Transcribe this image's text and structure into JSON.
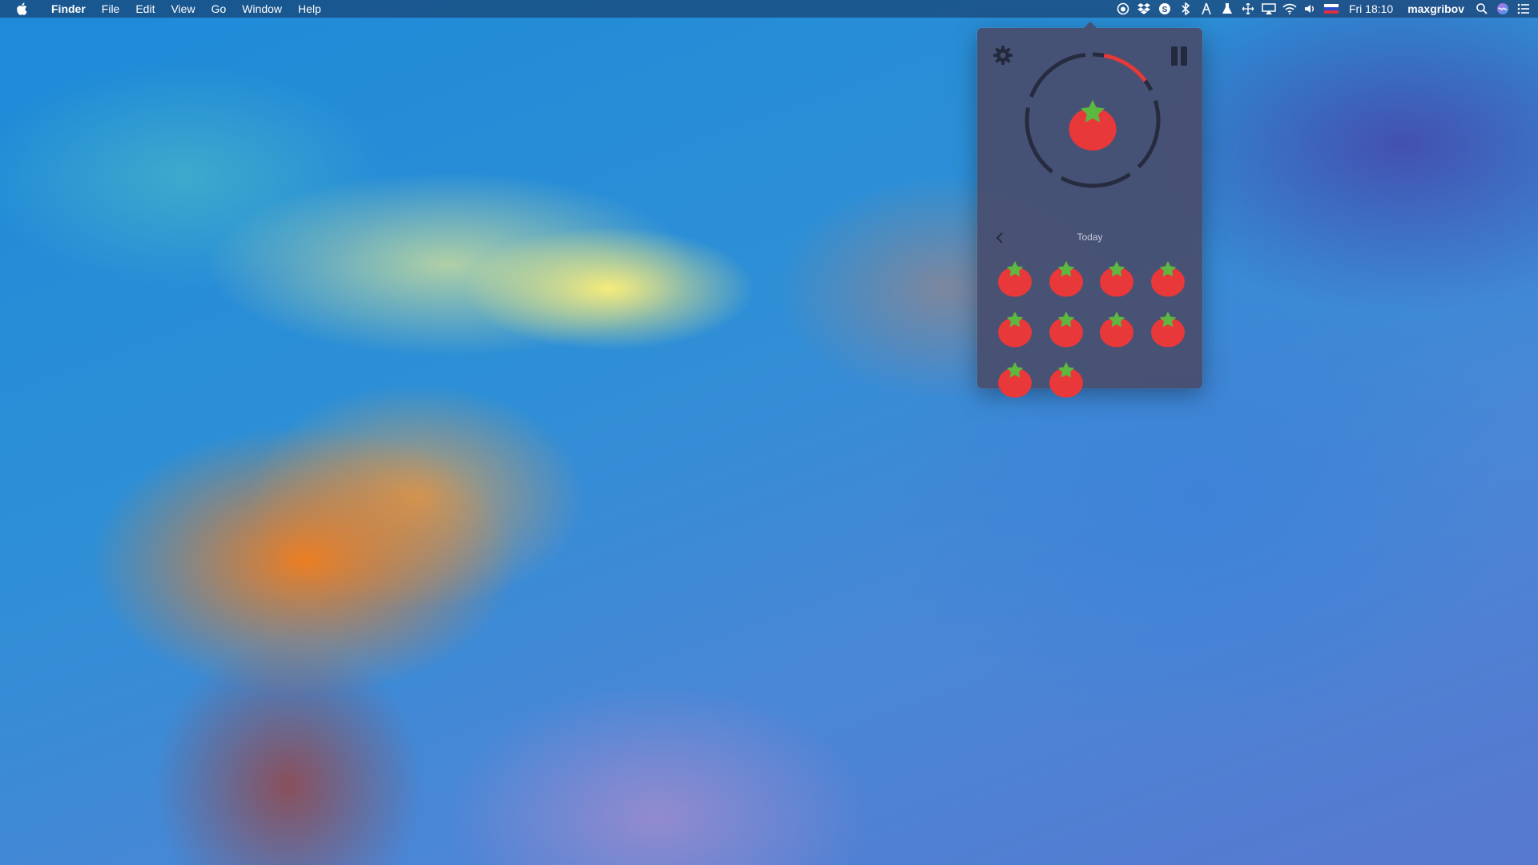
{
  "menubar": {
    "app_name": "Finder",
    "menus": [
      "File",
      "Edit",
      "View",
      "Go",
      "Window",
      "Help"
    ],
    "tray_icons": [
      "pomodoro-timer-icon",
      "dropbox-icon",
      "skype-icon",
      "bluetooth-icon",
      "scrivener-icon",
      "flask-icon",
      "move-icon",
      "airplay-icon",
      "wifi-icon",
      "volume-icon",
      "russian-flag-icon"
    ],
    "clock": "Fri 18:10",
    "user": "maxgribov"
  },
  "popover": {
    "settings_icon": "gear-icon",
    "pause_icon": "pause-icon",
    "timer_progress": 0.12,
    "day_label": "Today",
    "completed_tomatoes": 10,
    "colors": {
      "panel": "#484e6e",
      "ring_track": "#2a2f45",
      "ring_progress": "#e53a3a",
      "tomato": "#e8383a",
      "leaf": "#5cb840"
    }
  }
}
